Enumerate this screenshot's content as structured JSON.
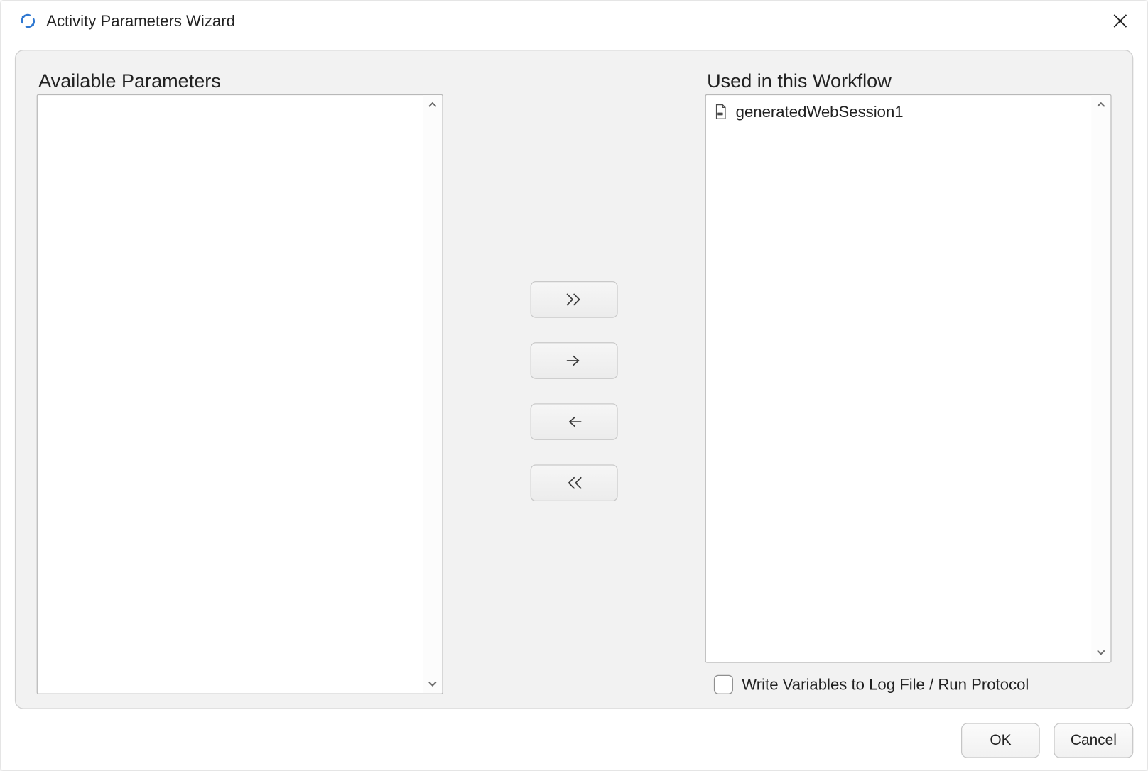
{
  "titlebar": {
    "title": "Activity Parameters Wizard"
  },
  "panels": {
    "available": {
      "label": "Available Parameters",
      "items": []
    },
    "used": {
      "label": "Used in this Workflow",
      "items": [
        {
          "label": "generatedWebSession1"
        }
      ]
    }
  },
  "checkbox": {
    "label": "Write Variables to Log File / Run Protocol",
    "checked": false
  },
  "buttons": {
    "ok": "OK",
    "cancel": "Cancel"
  }
}
